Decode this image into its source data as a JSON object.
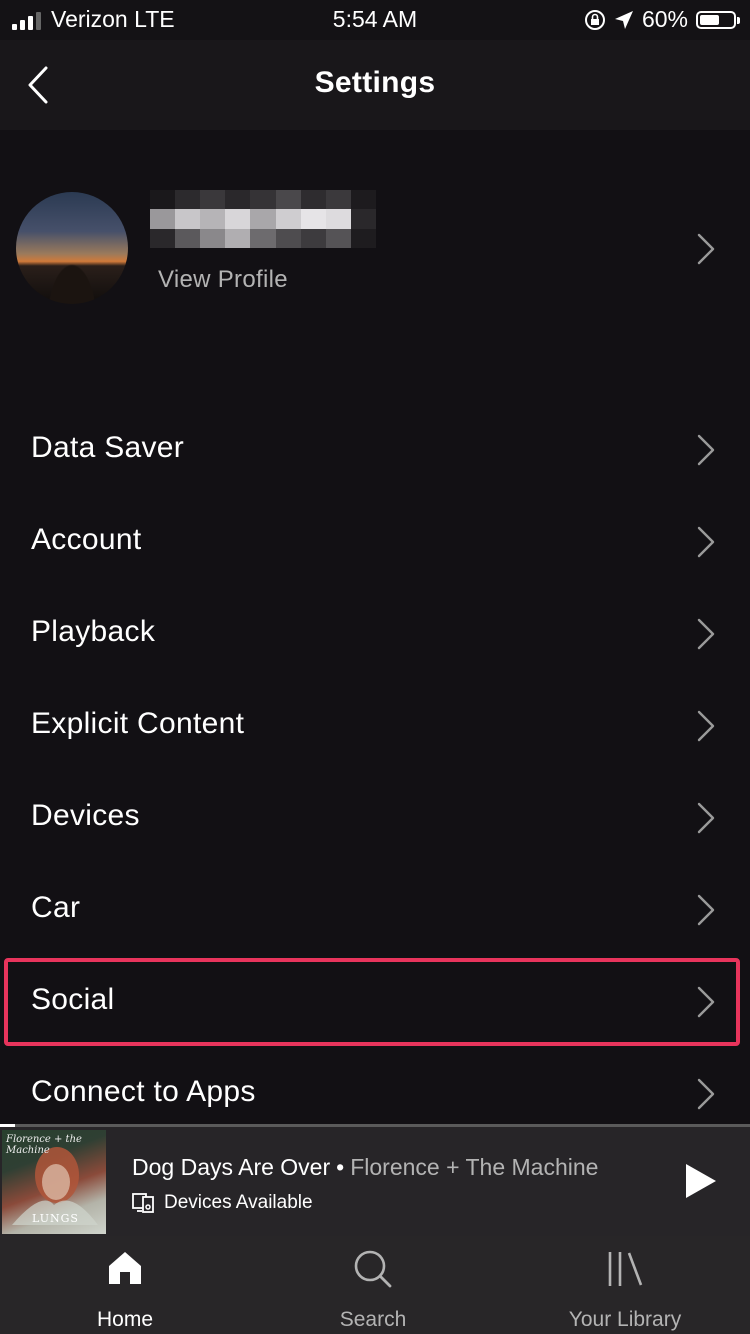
{
  "status_bar": {
    "carrier": "Verizon LTE",
    "time": "5:54 AM",
    "battery": "60%",
    "battery_level": 0.6
  },
  "header": {
    "title": "Settings",
    "back_icon": "chevron-left-icon"
  },
  "profile": {
    "view_profile_label": "View Profile"
  },
  "menu": [
    {
      "label": "Data Saver"
    },
    {
      "label": "Account"
    },
    {
      "label": "Playback"
    },
    {
      "label": "Explicit Content"
    },
    {
      "label": "Devices"
    },
    {
      "label": "Car"
    },
    {
      "label": "Social",
      "highlighted": true
    },
    {
      "label": "Connect to Apps"
    }
  ],
  "now_playing": {
    "song": "Dog Days Are Over",
    "separator": "•",
    "artist": "Florence + The Machine",
    "devices_label": "Devices Available",
    "album_artist_text": "Florence + the Machine",
    "album_title_text": "LUNGS",
    "progress": 0.02
  },
  "tabs": [
    {
      "label": "Home",
      "icon": "home-icon",
      "active": true
    },
    {
      "label": "Search",
      "icon": "search-icon",
      "active": false
    },
    {
      "label": "Your Library",
      "icon": "library-icon",
      "active": false
    }
  ],
  "colors": {
    "background": "#121014",
    "highlight": "#e8345c",
    "secondary_text": "#b3b3b3"
  }
}
